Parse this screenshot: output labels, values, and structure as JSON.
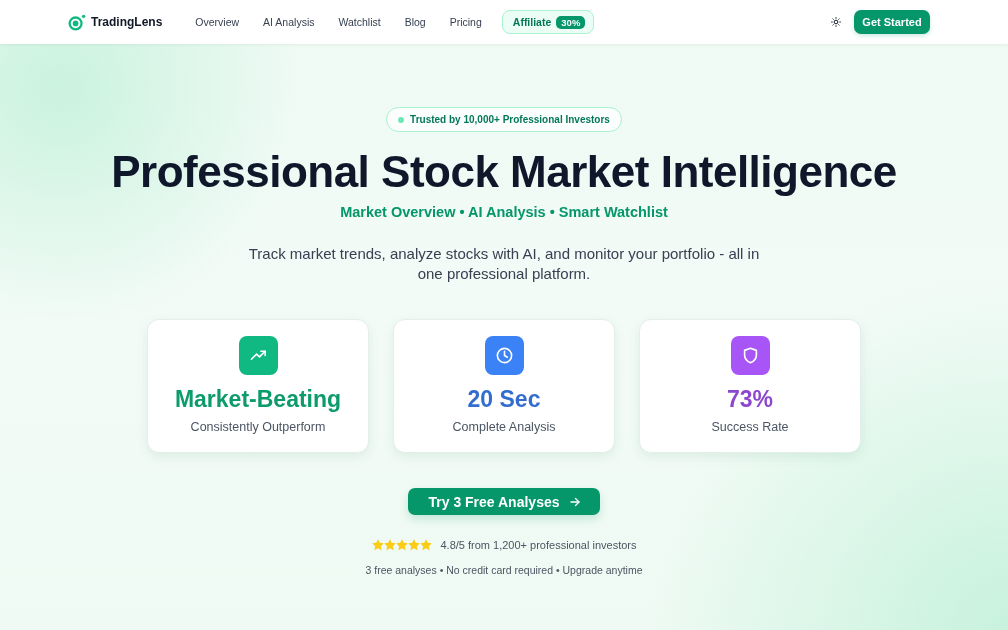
{
  "nav": {
    "brand": "TradingLens",
    "links": [
      {
        "label": "Overview"
      },
      {
        "label": "AI Analysis"
      },
      {
        "label": "Watchlist"
      },
      {
        "label": "Blog"
      },
      {
        "label": "Pricing"
      }
    ],
    "affiliate": {
      "label": "Affiliate",
      "badge": "30%"
    },
    "cta": "Get Started"
  },
  "hero": {
    "badge": "Trusted by 10,000+ Professional Investors",
    "title": "Professional Stock Market Intelligence",
    "tagline": "Market Overview • AI Analysis • Smart Watchlist",
    "description": "Track market trends, analyze stocks with AI, and monitor your portfolio - all in one professional platform."
  },
  "stats": [
    {
      "kind": "trend",
      "color": "#10b981",
      "value": "Market-Beating",
      "label": "Consistently Outperform"
    },
    {
      "kind": "clock",
      "color": "#3b82f6",
      "value": "20 Sec",
      "label": "Complete Analysis"
    },
    {
      "kind": "shield",
      "color": "#a855f7",
      "value": "73%",
      "label": "Success Rate"
    }
  ],
  "cta": "Try 3 Free Analyses",
  "rating": {
    "stars": 5,
    "text": "4.8/5 from 1,200+ professional investors"
  },
  "note": "3 free analyses • No credit card required • Upgrade anytime"
}
